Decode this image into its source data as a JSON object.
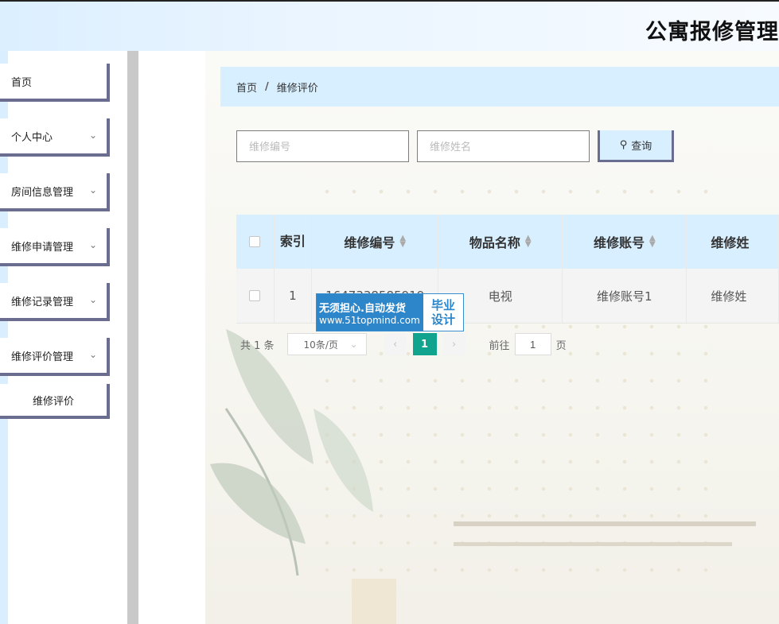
{
  "app": {
    "title": "公寓报修管理"
  },
  "sidebar": {
    "items": [
      {
        "label": "首页",
        "has_arrow": false
      },
      {
        "label": "个人中心",
        "has_arrow": true
      },
      {
        "label": "房间信息管理",
        "has_arrow": true
      },
      {
        "label": "维修申请管理",
        "has_arrow": true
      },
      {
        "label": "维修记录管理",
        "has_arrow": true
      },
      {
        "label": "维修评价管理",
        "has_arrow": true
      },
      {
        "label": "维修评价",
        "has_arrow": false,
        "submenu": true
      }
    ],
    "chevron_icon": "chevron-down-icon"
  },
  "breadcrumb": {
    "home": "首页",
    "separator": "/",
    "current": "维修评价"
  },
  "search": {
    "field1_placeholder": "维修编号",
    "field2_placeholder": "维修姓名",
    "button_label": "查询",
    "button_icon": "search-icon"
  },
  "table": {
    "columns": [
      "索引",
      "维修编号",
      "物品名称",
      "维修账号",
      "维修姓"
    ],
    "rows": [
      {
        "index": "1",
        "repair_no": "1647338585919",
        "item_name": "电视",
        "account": "维修账号1",
        "name": "维修姓"
      }
    ]
  },
  "watermark": {
    "line1": "无须担心.自动发货",
    "line2": "www.51topmind.com",
    "right1": "毕业",
    "right2": "设计"
  },
  "pagination": {
    "total": "共 1 条",
    "page_size": "10条/页",
    "current_page": "1",
    "goto_label": "前往",
    "goto_value": "1",
    "page_suffix": "页"
  },
  "colors": {
    "accent": "#d8efff",
    "active_page": "#10a48f",
    "button_border": "#6a6d8f"
  }
}
